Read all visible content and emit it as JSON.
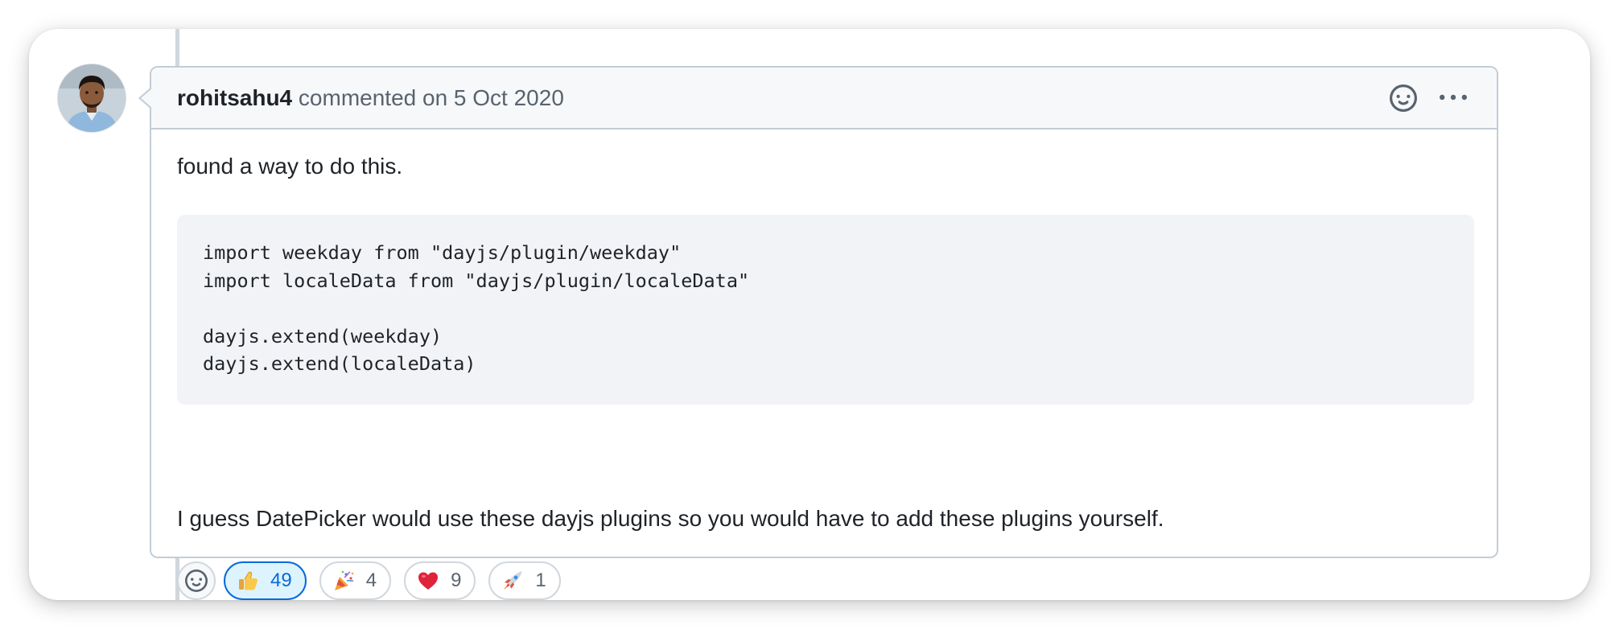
{
  "comment": {
    "author": "rohitsahu4",
    "action_text": "commented on 5 Oct 2020",
    "header_icons": [
      "smiley-icon",
      "kebab-horizontal-icon"
    ],
    "body": {
      "paragraph_1": "found a way to do this.",
      "code_lines": [
        "import weekday from \"dayjs/plugin/weekday\"",
        "import localeData from \"dayjs/plugin/localeData\"",
        "",
        "dayjs.extend(weekday)",
        "dayjs.extend(localeData)"
      ],
      "paragraph_2": "I guess DatePicker would use these dayjs plugins so you would have to add these plugins yourself."
    },
    "reactions": {
      "add_icon": "smiley-icon",
      "items": [
        {
          "emoji": "thumbs-up-icon",
          "count": "49",
          "active": true
        },
        {
          "emoji": "party-popper-icon",
          "count": "4",
          "active": false
        },
        {
          "emoji": "red-heart-icon",
          "count": "9",
          "active": false
        },
        {
          "emoji": "rocket-icon",
          "count": "1",
          "active": false
        }
      ]
    }
  },
  "colors": {
    "accent": "#0969da",
    "active_reaction_bg": "#ddf4ff",
    "border": "#d0d7de",
    "text": "#1f2328",
    "muted": "#59636e"
  }
}
